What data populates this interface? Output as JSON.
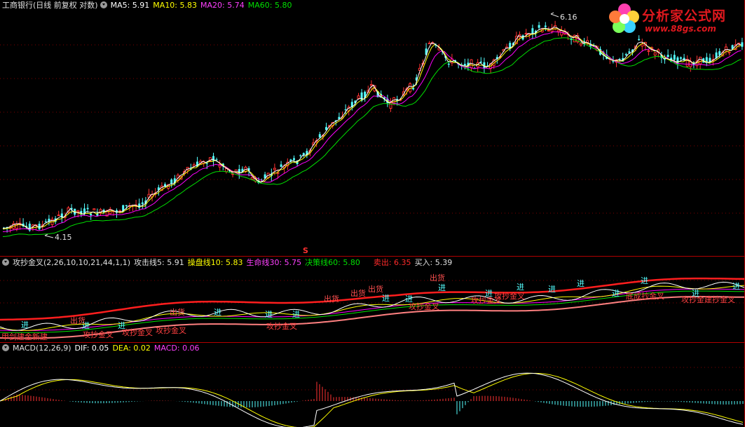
{
  "main_header": {
    "title": "工商银行(日线 前复权 对数)",
    "ma5": "MA5: 5.91",
    "ma10": "MA10: 5.83",
    "ma20": "MA20: 5.74",
    "ma60": "MA60: 5.80"
  },
  "price_marks": {
    "high": "6.16",
    "low": "4.15",
    "signal_mark": "S"
  },
  "logo": {
    "name": "分析家公式网",
    "url": "www.88gs.com"
  },
  "indicator_header": {
    "name": "攻抄金叉(2,26,10,10,21,44,1,1)",
    "attack": "攻击线5: 5.91",
    "control": "操盘线10: 5.83",
    "life": "生命线30: 5.75",
    "decision": "决策线60: 5.80",
    "sell": "卖出: 6.35",
    "buy": "买入: 5.39"
  },
  "indicator_labels": {
    "in": "进",
    "out": "出货",
    "attack_cross": "攻抄金叉",
    "bottom_cross": "底成抄金叉",
    "strong_cross": "攻抄金建抄金叉",
    "left_text": "甲剑建金新建"
  },
  "macd_header": {
    "name": "MACD(12,26,9)",
    "dif": "DIF: 0.05",
    "dea": "DEA: 0.02",
    "macd": "MACD: 0.06"
  },
  "colors": {
    "up": "#ff3232",
    "down": "#54ffff",
    "ma5": "#ffffff",
    "ma10": "#ffff00",
    "ma20": "#ff00ff",
    "ma60": "#00e000",
    "sell": "#ff1e1e",
    "buy": "#ff8080"
  }
}
